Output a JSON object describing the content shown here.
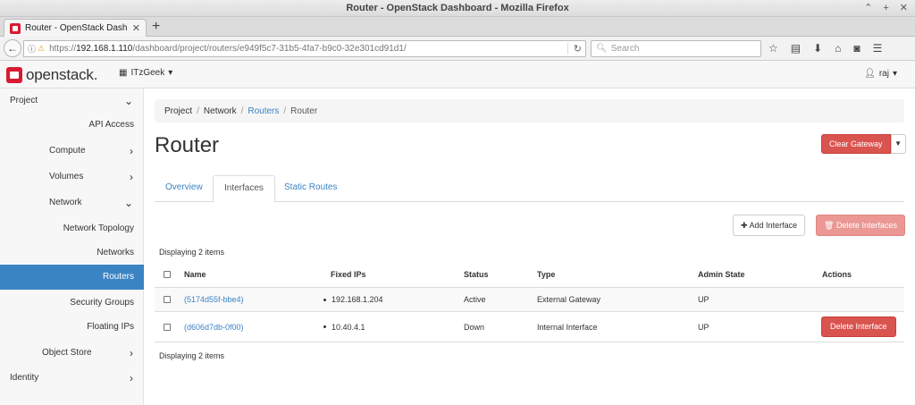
{
  "window": {
    "title": "Router - OpenStack Dashboard - Mozilla Firefox",
    "controls": [
      "⌃",
      "+",
      "✕"
    ]
  },
  "browser": {
    "tab_title": "Router - OpenStack Dashbo",
    "url_prefix": "https://",
    "url_host": "192.168.1.110",
    "url_path": "/dashboard/project/routers/e949f5c7-31b5-4fa7-b9c0-32e301cd91d1/",
    "search_placeholder": "Search"
  },
  "header": {
    "logo_text": "openstack",
    "logo_dot": ".",
    "project": "ITzGeek",
    "user": "raj"
  },
  "sidebar": {
    "project": "Project",
    "api_access": "API Access",
    "compute": "Compute",
    "volumes": "Volumes",
    "network": "Network",
    "network_topology": "Network Topology",
    "networks": "Networks",
    "routers": "Routers",
    "security_groups": "Security Groups",
    "floating_ips": "Floating IPs",
    "object_store": "Object Store",
    "identity": "Identity"
  },
  "breadcrumb": {
    "project": "Project",
    "network": "Network",
    "routers": "Routers",
    "router": "Router"
  },
  "page": {
    "title": "Router",
    "clear_gateway": "Clear Gateway",
    "tabs": {
      "overview": "Overview",
      "interfaces": "Interfaces",
      "static_routes": "Static Routes"
    },
    "add_interface": "Add Interface",
    "delete_interfaces": "Delete Interfaces",
    "count_text": "Displaying 2 items"
  },
  "table": {
    "headers": {
      "name": "Name",
      "fixed_ips": "Fixed IPs",
      "status": "Status",
      "type": "Type",
      "admin_state": "Admin State",
      "actions": "Actions"
    },
    "rows": [
      {
        "name": "(5174d55f-bbe4)",
        "fixed_ip": "192.168.1.204",
        "status": "Active",
        "type": "External Gateway",
        "admin_state": "UP",
        "action": ""
      },
      {
        "name": "(d606d7db-0f00)",
        "fixed_ip": "10.40.4.1",
        "status": "Down",
        "type": "Internal Interface",
        "admin_state": "UP",
        "action": "Delete Interface"
      }
    ]
  },
  "colors": {
    "brand_red": "#da1a32",
    "active_blue": "#3b84c4",
    "danger": "#d9534f"
  }
}
